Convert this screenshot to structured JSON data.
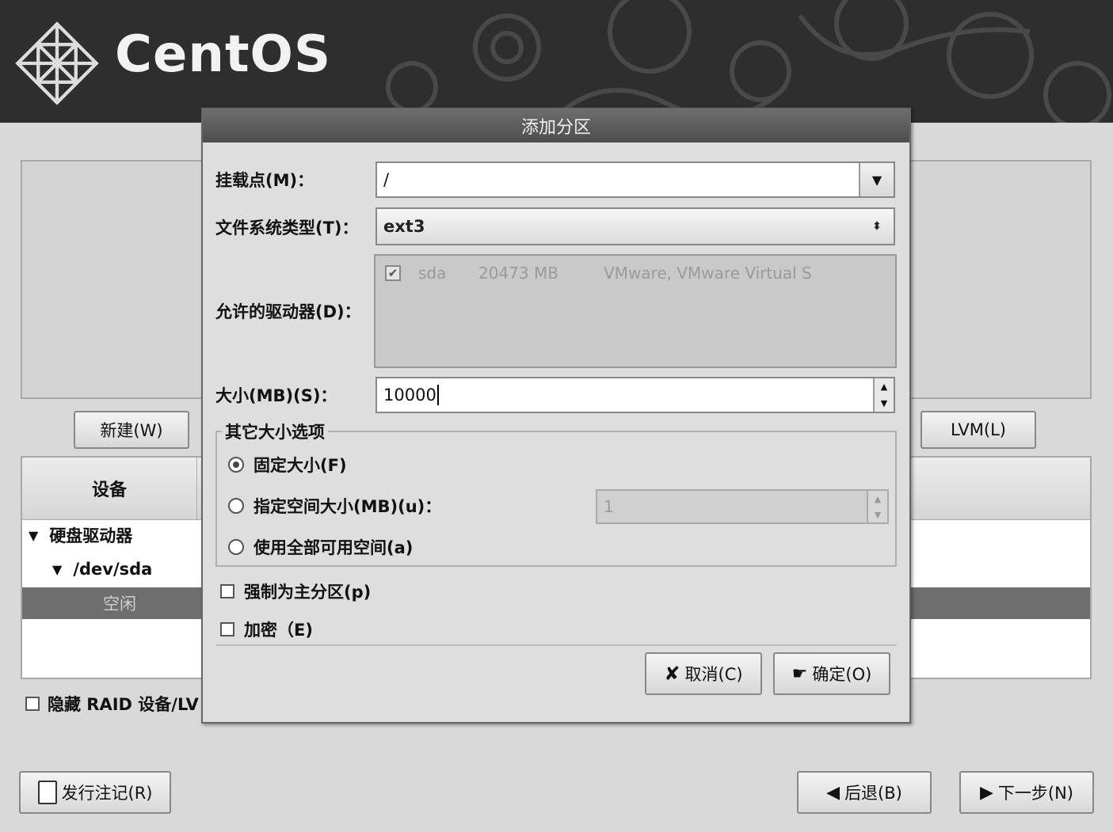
{
  "header": {
    "logo_text": "CentOS"
  },
  "background": {
    "new_button": "新建(W)",
    "lvm_button": "LVM(L)",
    "tree": {
      "column_device": "设备",
      "rows": [
        {
          "label": "硬盘驱动器"
        },
        {
          "label": "/dev/sda"
        },
        {
          "label": "空闲"
        }
      ]
    },
    "hide_raid_label": "隐藏 RAID 设备/LV",
    "release_notes_button": "发行注记(R)",
    "back_button": "后退(B)",
    "next_button": "下一步(N)"
  },
  "dialog": {
    "title": "添加分区",
    "mount_label": "挂载点(M)：",
    "mount_value": "/",
    "fs_label": "文件系统类型(T)：",
    "fs_value": "ext3",
    "drives_label": "允许的驱动器(D)：",
    "drives": [
      {
        "checked": true,
        "name": "sda",
        "size": "20473 MB",
        "model": "VMware, VMware Virtual S"
      }
    ],
    "size_label": "大小(MB)(S)：",
    "size_value": "10000",
    "other_size_title": "其它大小选项",
    "options": {
      "fixed": "固定大小(F)",
      "fill_to": "指定空间大小(MB)(u)：",
      "fill_all": "使用全部可用空间(a)"
    },
    "selected_option": "fixed",
    "fill_to_value": "1",
    "force_primary_label": "强制为主分区(p)",
    "encrypt_label": "加密（E)",
    "cancel_button": "取消(C)",
    "ok_button": "确定(O)"
  },
  "colors": {
    "banner": "#2e2e2e",
    "selected_row": "#6e6e6e",
    "dialog_title": "#555555"
  }
}
